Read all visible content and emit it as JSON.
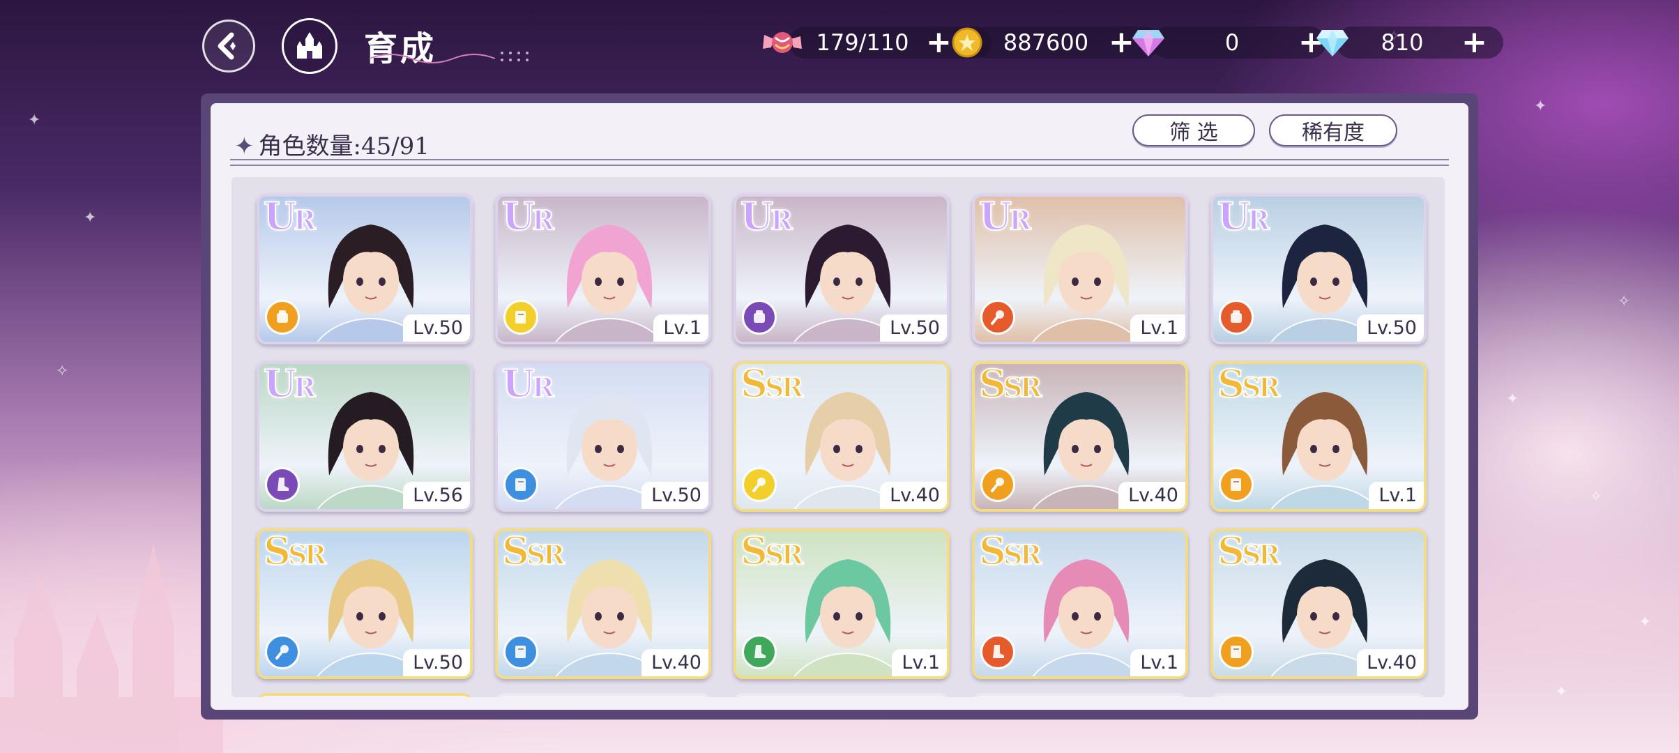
{
  "header": {
    "title": "育成",
    "back_icon": "back-arrow-icon",
    "home_icon": "castle-icon"
  },
  "resources": [
    {
      "name": "candy",
      "icon": "candy-icon",
      "value": "179/110",
      "color": "#e2587a"
    },
    {
      "name": "coin",
      "icon": "gold-coin-icon",
      "value": "887600",
      "color": "#f0b92a"
    },
    {
      "name": "gem-pink",
      "icon": "pink-diamond-icon",
      "value": "0",
      "color": "#d778e6"
    },
    {
      "name": "gem-blue",
      "icon": "blue-diamond-icon",
      "value": "810",
      "color": "#7fd6f5"
    }
  ],
  "panel": {
    "count_label": "角色数量:45/91",
    "filter_label": "筛 选",
    "sort_label": "稀有度"
  },
  "characters": [
    {
      "rarity": "UR",
      "level": "Lv.50",
      "element": "fist",
      "element_color": "#f0a01e",
      "hair": "#2a1e24",
      "bg": "#b6c9ea"
    },
    {
      "rarity": "UR",
      "level": "Lv.1",
      "element": "book",
      "element_color": "#f2cf2a",
      "hair": "#f1a4d2",
      "bg": "#c8b6c8"
    },
    {
      "rarity": "UR",
      "level": "Lv.50",
      "element": "fist",
      "element_color": "#7a4bb7",
      "hair": "#2c1b30",
      "bg": "#c9b5c7"
    },
    {
      "rarity": "UR",
      "level": "Lv.1",
      "element": "wand",
      "element_color": "#e65b2c",
      "hair": "#efe6c8",
      "bg": "#e0bfa8"
    },
    {
      "rarity": "UR",
      "level": "Lv.50",
      "element": "fist",
      "element_color": "#e65b2c",
      "hair": "#1d2440",
      "bg": "#b9cfe3"
    },
    {
      "rarity": "UR",
      "level": "Lv.56",
      "element": "boot",
      "element_color": "#7a4bb7",
      "hair": "#251b22",
      "bg": "#bcd8c6"
    },
    {
      "rarity": "UR",
      "level": "Lv.50",
      "element": "book",
      "element_color": "#3f8fe0",
      "hair": "#dfe6f2",
      "bg": "#d4dcf2"
    },
    {
      "rarity": "SSR",
      "level": "Lv.40",
      "element": "wand",
      "element_color": "#f2cf2a",
      "hair": "#e6cfa8",
      "bg": "#dfe7ee"
    },
    {
      "rarity": "SSR",
      "level": "Lv.40",
      "element": "wand",
      "element_color": "#f0a01e",
      "hair": "#1f3b48",
      "bg": "#c8b4b8"
    },
    {
      "rarity": "SSR",
      "level": "Lv.1",
      "element": "book",
      "element_color": "#f0a01e",
      "hair": "#8a5a3a",
      "bg": "#bfd8e6"
    },
    {
      "rarity": "SSR",
      "level": "Lv.50",
      "element": "wand",
      "element_color": "#3f8fe0",
      "hair": "#e9c986",
      "bg": "#bcd6ee"
    },
    {
      "rarity": "SSR",
      "level": "Lv.40",
      "element": "book",
      "element_color": "#3f8fe0",
      "hair": "#f0dfae",
      "bg": "#c2d8ea"
    },
    {
      "rarity": "SSR",
      "level": "Lv.1",
      "element": "boot",
      "element_color": "#3fa85a",
      "hair": "#6cc8a0",
      "bg": "#cfe3c2"
    },
    {
      "rarity": "SSR",
      "level": "Lv.1",
      "element": "boot",
      "element_color": "#e65b2c",
      "hair": "#e68ab6",
      "bg": "#c6d8ec"
    },
    {
      "rarity": "SSR",
      "level": "Lv.40",
      "element": "book",
      "element_color": "#f0a01e",
      "hair": "#1d2a3a",
      "bg": "#c9dbe8"
    }
  ]
}
